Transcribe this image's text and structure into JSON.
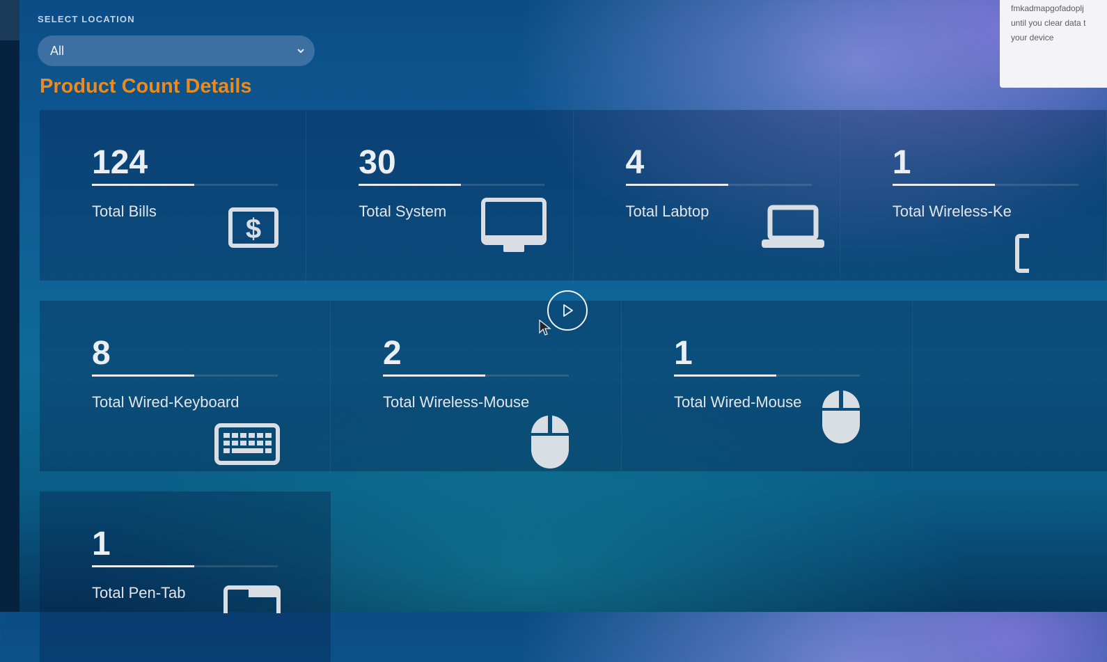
{
  "location_filter": {
    "label": "SELECT LOCATION",
    "selected": "All"
  },
  "section_title": "Product Count Details",
  "notification": {
    "lines": [
      "fmkadmapgofadoplj",
      "until you clear data t",
      "your device"
    ]
  },
  "cards": [
    {
      "count": "124",
      "label": "Total Bills",
      "icon": "dollar-bill-icon"
    },
    {
      "count": "30",
      "label": "Total System",
      "icon": "desktop-monitor-icon"
    },
    {
      "count": "4",
      "label": "Total Labtop",
      "icon": "laptop-icon"
    },
    {
      "count": "1",
      "label": "Total Wireless-Ke",
      "icon": "keyboard-icon"
    },
    {
      "count": "8",
      "label": "Total Wired-Keyboard",
      "icon": "keyboard-icon"
    },
    {
      "count": "2",
      "label": "Total Wireless-Mouse",
      "icon": "mouse-icon"
    },
    {
      "count": "1",
      "label": "Total Wired-Mouse",
      "icon": "mouse-icon"
    },
    {
      "count": "1",
      "label": "Total Pen-Tab",
      "icon": "tablet-icon"
    }
  ],
  "overlay": {
    "play_icon": "play-icon",
    "cursor_icon": "cursor-icon"
  },
  "colors": {
    "accent": "#ea8a1f",
    "text": "#e6e9ee"
  }
}
